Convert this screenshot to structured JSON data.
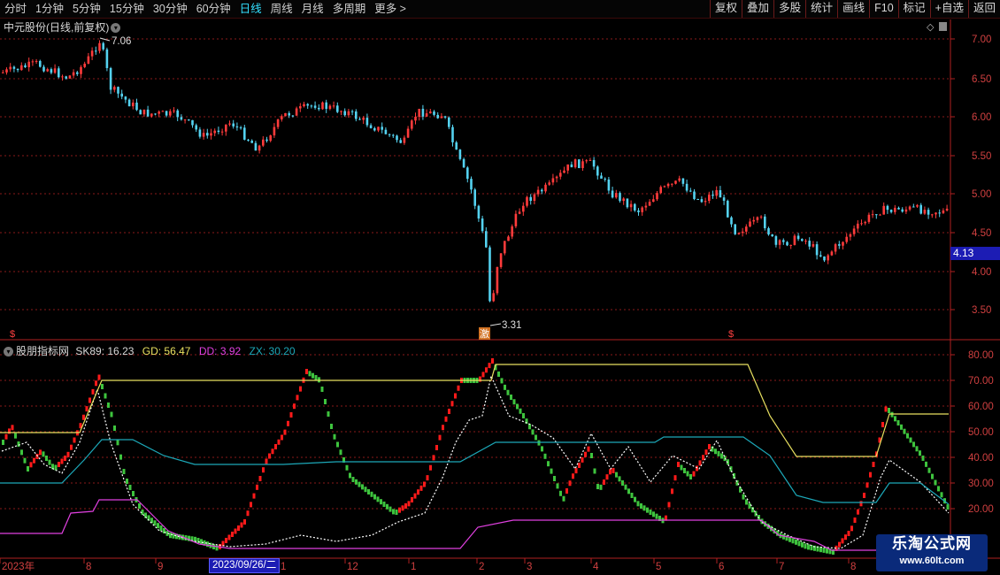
{
  "toolbar": {
    "left": [
      "分时",
      "1分钟",
      "5分钟",
      "15分钟",
      "30分钟",
      "60分钟",
      "日线",
      "周线",
      "月线",
      "多周期",
      "更多 >"
    ],
    "active": "日线",
    "right": [
      "复权",
      "叠加",
      "多股",
      "统计",
      "画线",
      "F10",
      "标记",
      "+自选",
      "返回"
    ]
  },
  "price_panel": {
    "title": "中元股份(日线,前复权)",
    "high_label": "7.06",
    "low_label": "3.31",
    "current_price": "4.13",
    "s_marker": "$",
    "low_marker": "激",
    "y_ticks": [
      "7.00",
      "6.50",
      "6.00",
      "5.50",
      "5.00",
      "4.50",
      "4.00",
      "3.50"
    ]
  },
  "indicator_panel": {
    "name": "股朋指标网",
    "legend": [
      {
        "label": "SK89: 16.23",
        "color": "#d8d8d8"
      },
      {
        "label": "GD: 56.47",
        "color": "#e8e060"
      },
      {
        "label": "DD: 3.92",
        "color": "#e040e0"
      },
      {
        "label": "ZX: 30.20",
        "color": "#1ca8b8"
      }
    ],
    "y_ticks": [
      "80.00",
      "70.00",
      "60.00",
      "50.00",
      "40.00",
      "30.00",
      "20.00"
    ]
  },
  "date_axis": {
    "labels": [
      "2023年",
      "8",
      "9",
      "1",
      "12",
      "1",
      "2",
      "3",
      "4",
      "5",
      "6",
      "7",
      "8"
    ],
    "hover_date": "2023/09/26/二"
  },
  "watermark": {
    "line1": "乐淘公式网",
    "line2": "www.60lt.com"
  },
  "colors": {
    "up": "#ff3b3b",
    "down": "#54d2f0",
    "bar_up": "#ff1a1a",
    "bar_down": "#3ec43e",
    "grid": "#8a1a1a",
    "gd": "#e8e060",
    "dd": "#e040e0",
    "zx": "#1ca8b8",
    "sk89": "#ffffff"
  }
}
